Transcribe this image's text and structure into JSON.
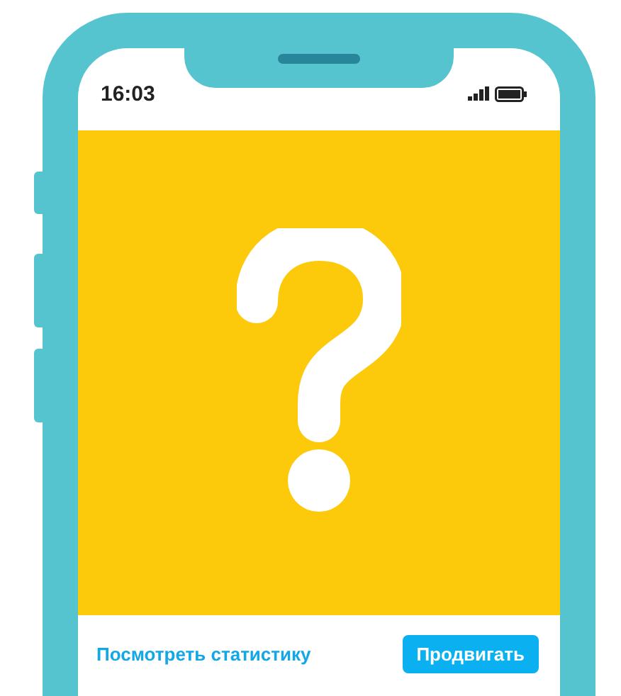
{
  "status_bar": {
    "time": "16:03"
  },
  "footer": {
    "link": "Посмотреть статистику",
    "button": "Продвигать"
  }
}
